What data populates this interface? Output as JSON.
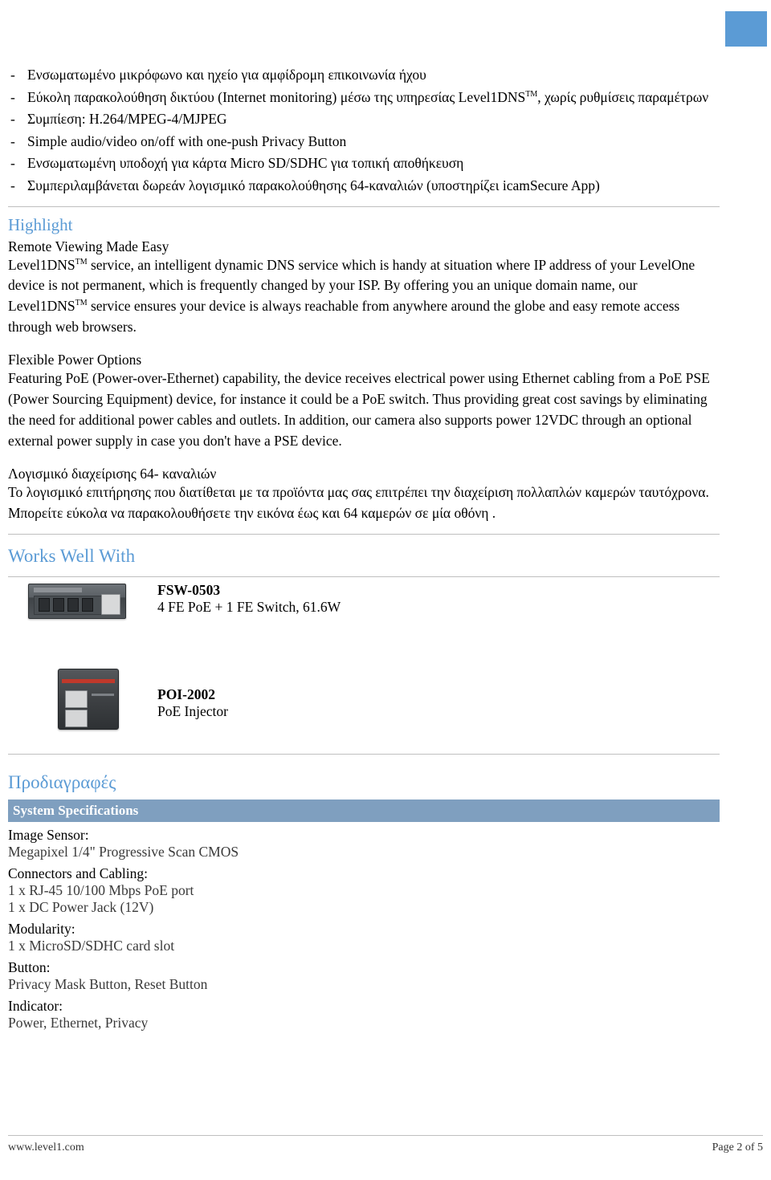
{
  "features": [
    "Ενσωματωμένο μικρόφωνο και ηχείο για αμφίδρομη επικοινωνία ήχου",
    "Εύκολη παρακολούθηση δικτύου (Internet monitoring) μέσω της υπηρεσίας Level1DNS™, χωρίς ρυθμίσεις παραμέτρων",
    "Συμπίεση: H.264/MPEG-4/MJPEG",
    "Simple audio/video on/off with one-push Privacy Button",
    "Ενσωματωμένη υποδοχή για κάρτα Micro SD/SDHC για τοπική αποθήκευση",
    "Συμπεριλαμβάνεται δωρεάν λογισμικό παρακολούθησης 64-καναλιών (υποστηρίζει icamSecure App)"
  ],
  "highlight": {
    "heading": "Highlight",
    "blocks": [
      {
        "title": "Remote Viewing Made Easy",
        "text": "Level1DNS™ service, an intelligent dynamic DNS service which is handy at situation where IP address of your LevelOne device is not permanent, which is frequently changed by your ISP. By offering you an unique domain name, our Level1DNS™ service ensures your device is always reachable from anywhere around the globe and easy remote access through web browsers."
      },
      {
        "title": "Flexible Power Options",
        "text": "Featuring PoE (Power-over-Ethernet) capability, the device receives electrical power using Ethernet cabling from a PoE PSE (Power Sourcing Equipment) device, for instance it could be a PoE switch. Thus providing great cost savings by eliminating the need for additional power cables and outlets. In addition, our camera also supports power 12VDC through an optional external power supply in case you don't have a PSE device."
      },
      {
        "title": "Λογισμικό διαχείρισης 64- καναλιών",
        "text": "Το λογισμικό επιτήρησης που διατίθεται με τα προϊόντα μας σας επιτρέπει την διαχείριση πολλαπλών καμερών ταυτόχρονα. Μπορείτε εύκολα να παρακολουθήσετε την εικόνα έως και 64 καμερών σε μία οθόνη ."
      }
    ]
  },
  "works_well_with": {
    "heading": "Works Well With",
    "products": [
      {
        "name": "FSW-0503",
        "description": "4 FE PoE + 1 FE Switch, 61.6W",
        "image": "network-switch-image"
      },
      {
        "name": "POI-2002",
        "description": "PoE Injector",
        "image": "poe-injector-image"
      }
    ]
  },
  "specifications": {
    "heading": "Προδιαγραφές",
    "table_header": "System Specifications",
    "rows": [
      {
        "label": "Image Sensor:",
        "values": [
          "Megapixel 1/4\" Progressive Scan CMOS"
        ]
      },
      {
        "label": "Connectors and Cabling:",
        "values": [
          "1 x RJ-45 10/100 Mbps PoE port",
          "1 x DC Power Jack (12V)"
        ]
      },
      {
        "label": "Modularity:",
        "values": [
          "1 x MicroSD/SDHC card slot"
        ]
      },
      {
        "label": "Button:",
        "values": [
          "Privacy Mask Button, Reset Button"
        ]
      },
      {
        "label": "Indicator:",
        "values": [
          "Power, Ethernet,  Privacy"
        ]
      }
    ]
  },
  "footer": {
    "site": "www.level1.com",
    "page": "Page 2 of 5"
  },
  "colors": {
    "accent": "#5b9bd5",
    "table_header_bg": "#7f9fbf",
    "rule": "#bfbfbf"
  }
}
